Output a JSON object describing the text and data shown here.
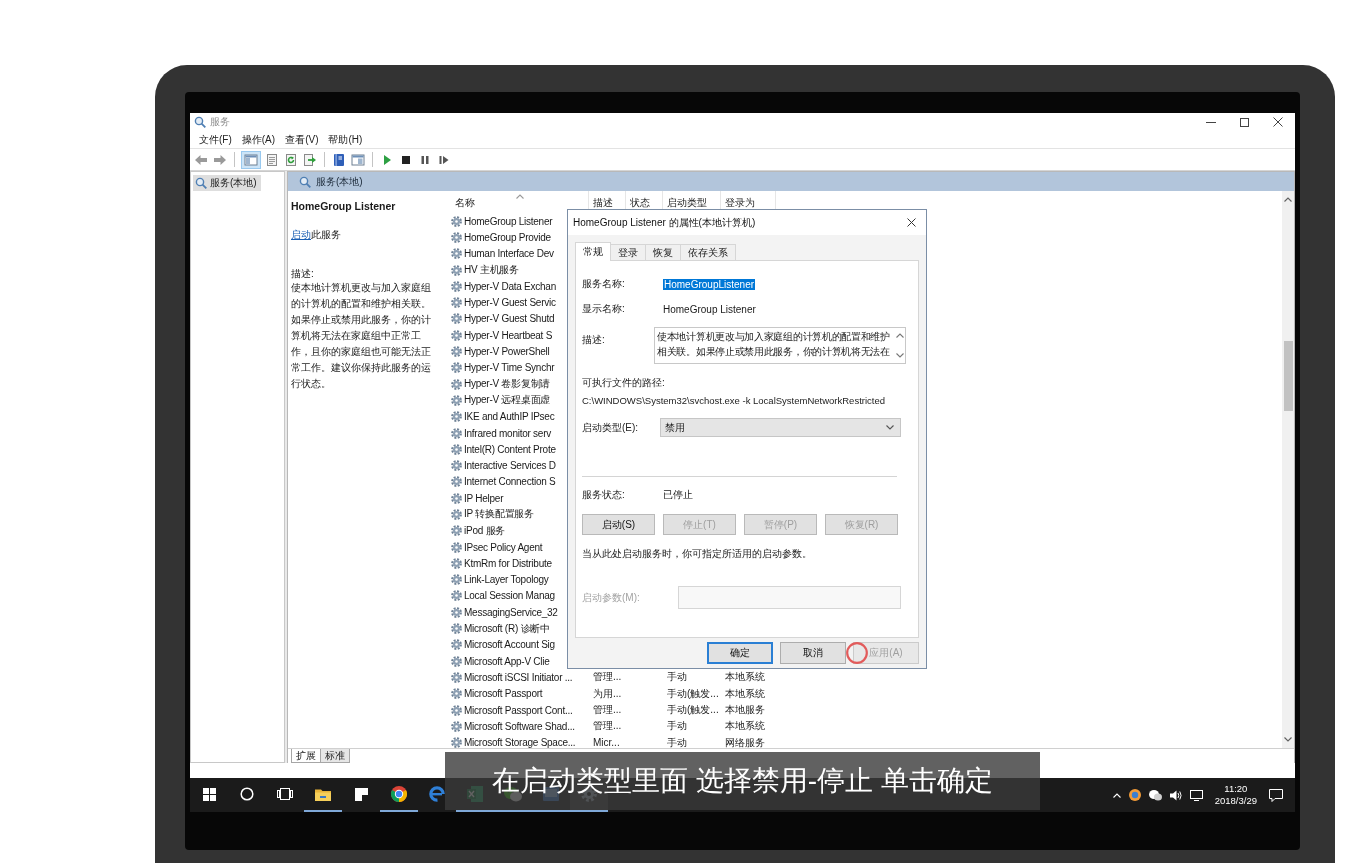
{
  "window": {
    "title": "服务",
    "menu": [
      "文件(F)",
      "操作(A)",
      "查看(V)",
      "帮助(H)"
    ]
  },
  "toolbar": {
    "console_tree_pressed": true
  },
  "tree": {
    "items": [
      {
        "label": "服务(本地)",
        "selected": true
      }
    ]
  },
  "panel": {
    "header": "服务(本地)",
    "details": {
      "name": "HomeGroup Listener",
      "action_link": "启动",
      "action_text": "此服务",
      "description_label": "描述:",
      "description": "使本地计算机更改与加入家庭组的计算机的配置和维护相关联。如果停止或禁用此服务，你的计算机将无法在家庭组中正常工作，且你的家庭组也可能无法正常工作。建议你保持此服务的运行状态。"
    },
    "columns": [
      "名称",
      "描述",
      "状态",
      "启动类型",
      "登录为"
    ],
    "rows": [
      {
        "name": "HomeGroup Listener"
      },
      {
        "name": "HomeGroup Provide"
      },
      {
        "name": "Human Interface Dev"
      },
      {
        "name": "HV 主机服务"
      },
      {
        "name": "Hyper-V Data Exchan"
      },
      {
        "name": "Hyper-V Guest Servic"
      },
      {
        "name": "Hyper-V Guest Shutd"
      },
      {
        "name": "Hyper-V Heartbeat S"
      },
      {
        "name": "Hyper-V PowerShell"
      },
      {
        "name": "Hyper-V Time Synchr"
      },
      {
        "name": "Hyper-V 卷影复制请"
      },
      {
        "name": "Hyper-V 远程桌面虚"
      },
      {
        "name": "IKE and AuthIP IPsec"
      },
      {
        "name": "Infrared monitor serv"
      },
      {
        "name": "Intel(R) Content Prote"
      },
      {
        "name": "Interactive Services D"
      },
      {
        "name": "Internet Connection S"
      },
      {
        "name": "IP Helper"
      },
      {
        "name": "IP 转换配置服务"
      },
      {
        "name": "iPod 服务"
      },
      {
        "name": "IPsec Policy Agent"
      },
      {
        "name": "KtmRm for Distribute"
      },
      {
        "name": "Link-Layer Topology"
      },
      {
        "name": "Local Session Manag"
      },
      {
        "name": "MessagingService_32"
      },
      {
        "name": "Microsoft (R) 诊断中"
      },
      {
        "name": "Microsoft Account Sig"
      },
      {
        "name": "Microsoft App-V Clie"
      },
      {
        "name": "Microsoft iSCSI Initiator ...",
        "description": "管理...",
        "startup_type": "手动",
        "log_on_as": "本地系统"
      },
      {
        "name": "Microsoft Passport",
        "description": "为用...",
        "startup_type": "手动(触发...",
        "log_on_as": "本地系统"
      },
      {
        "name": "Microsoft Passport Cont...",
        "description": "管理...",
        "startup_type": "手动(触发...",
        "log_on_as": "本地服务"
      },
      {
        "name": "Microsoft Software Shad...",
        "description": "管理...",
        "startup_type": "手动",
        "log_on_as": "本地系统"
      },
      {
        "name": "Microsoft Storage Space...",
        "description": "Micr...",
        "startup_type": "手动",
        "log_on_as": "网络服务"
      }
    ],
    "view_tabs": [
      {
        "label": "扩展",
        "selected": true
      },
      {
        "label": "标准",
        "selected": false
      }
    ]
  },
  "dialog": {
    "title": "HomeGroup Listener 的属性(本地计算机)",
    "tabs": [
      {
        "label": "常规",
        "selected": true
      },
      {
        "label": "登录",
        "selected": false
      },
      {
        "label": "恢复",
        "selected": false
      },
      {
        "label": "依存关系",
        "selected": false
      }
    ],
    "service_name": {
      "label": "服务名称:",
      "value": "HomeGroupListener",
      "selected": true
    },
    "display_name": {
      "label": "显示名称:",
      "value": "HomeGroup Listener"
    },
    "description": {
      "label": "描述:",
      "lines": [
        "使本地计算机更改与加入家庭组的计算机的配置和维护",
        "相关联。如果停止或禁用此服务，你的计算机将无法在"
      ]
    },
    "path": {
      "label": "可执行文件的路径:",
      "value": "C:\\WINDOWS\\System32\\svchost.exe -k LocalSystemNetworkRestricted"
    },
    "startup_type": {
      "label": "启动类型(E):",
      "value": "禁用"
    },
    "service_status": {
      "label": "服务状态:",
      "value": "已停止"
    },
    "control_buttons": [
      {
        "label": "启动(S)",
        "disabled": false
      },
      {
        "label": "停止(T)",
        "disabled": true
      },
      {
        "label": "暂停(P)",
        "disabled": true
      },
      {
        "label": "恢复(R)",
        "disabled": true
      }
    ],
    "hint": "当从此处启动服务时，你可指定所适用的启动参数。",
    "start_params": {
      "label": "启动参数(M):",
      "disabled": true
    },
    "buttons": [
      {
        "label": "确定",
        "default": true,
        "disabled": false,
        "clicked": false
      },
      {
        "label": "取消",
        "default": false,
        "disabled": false,
        "clicked": false
      },
      {
        "label": "应用(A)",
        "default": false,
        "disabled": true,
        "clicked": true
      }
    ]
  },
  "taskbar": {
    "apps": [
      {
        "kind": "start",
        "running": false,
        "active": false
      },
      {
        "kind": "search",
        "running": false,
        "active": false
      },
      {
        "kind": "task_view",
        "running": false,
        "active": false
      },
      {
        "kind": "explorer",
        "running": true,
        "active": false
      },
      {
        "kind": "notes",
        "running": false,
        "active": false
      },
      {
        "kind": "chrome",
        "running": true,
        "active": false
      },
      {
        "kind": "edge",
        "running": false,
        "active": false
      },
      {
        "kind": "excel",
        "running": true,
        "active": false
      },
      {
        "kind": "wechat",
        "running": true,
        "active": false
      },
      {
        "kind": "app",
        "running": true,
        "active": false
      },
      {
        "kind": "services",
        "running": true,
        "active": true
      }
    ],
    "time": "11:20",
    "date": "2018/3/29"
  },
  "caption": "在启动类型里面 选择禁用-停止 单击确定"
}
